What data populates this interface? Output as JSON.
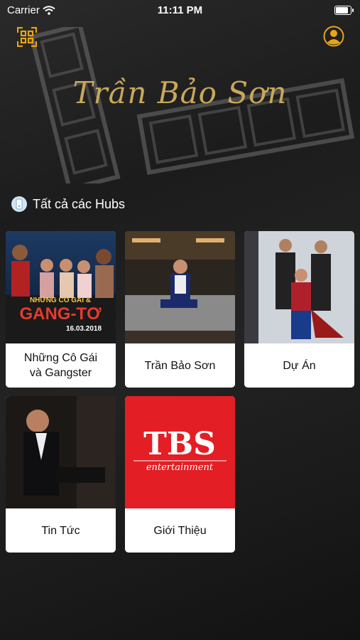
{
  "status": {
    "carrier": "Carrier",
    "time": "11:11 PM"
  },
  "header": {
    "title": "Trần Bảo Sơn"
  },
  "section": {
    "title": "Tất cả các Hubs"
  },
  "hubs": [
    {
      "label_line1": "Những Cô Gái",
      "label_line2": "và Gangster",
      "poster_text1": "NHỮNG CÔ GÁI &",
      "poster_text2": "GANG-TƠ",
      "poster_date": "16.03.2018"
    },
    {
      "label": "Trần Bảo Sơn"
    },
    {
      "label": "Dự Án"
    },
    {
      "label": "Tin Tức"
    },
    {
      "label": "Giới Thiệu",
      "logo_main": "TBS",
      "logo_sub": "entertainment"
    }
  ],
  "colors": {
    "accent": "#e8a317",
    "gold": "#c9a85a",
    "tbs_red": "#e31e24"
  },
  "icons": {
    "qr": "qr-scan-icon",
    "user": "user-profile-icon"
  }
}
